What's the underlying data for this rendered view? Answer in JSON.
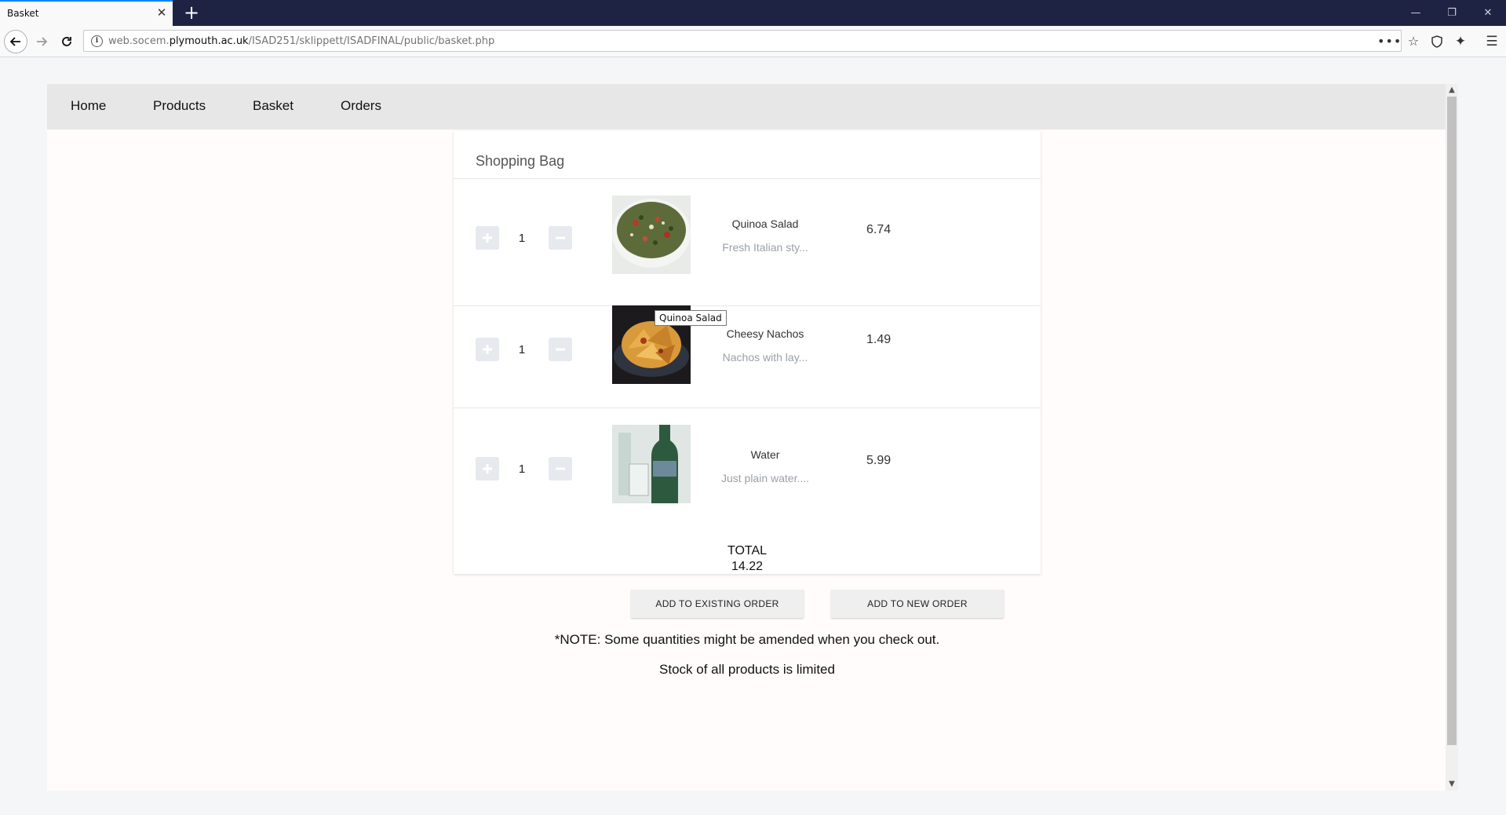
{
  "browser": {
    "tab_title": "Basket",
    "tab_close": "✕",
    "new_tab": "+",
    "url_prefix": "web.socem.",
    "url_host": "plymouth.ac.uk",
    "url_path": "/ISAD251/sklippett/ISADFINAL/public/basket.php",
    "window_controls": {
      "minimize": "—",
      "restore": "❐",
      "close": "✕"
    }
  },
  "site_nav": [
    "Home",
    "Products",
    "Basket",
    "Orders"
  ],
  "basket": {
    "title": "Shopping Bag",
    "items": [
      {
        "name": "Quinoa Salad",
        "desc": "Fresh Italian sty...",
        "qty": "1",
        "price": "6.74"
      },
      {
        "name": "Cheesy Nachos",
        "desc": "Nachos with lay...",
        "qty": "1",
        "price": "1.49"
      },
      {
        "name": "Water",
        "desc": "Just plain water....",
        "qty": "1",
        "price": "5.99"
      }
    ],
    "total_label": "TOTAL",
    "total_value": "14.22"
  },
  "actions": {
    "existing": "ADD TO EXISTING ORDER",
    "new": "ADD TO NEW ORDER"
  },
  "notes": {
    "note1": "*NOTE: Some quantities might be amended when you check out.",
    "note2": "Stock of all products is limited"
  },
  "tooltip": "Quinoa Salad"
}
